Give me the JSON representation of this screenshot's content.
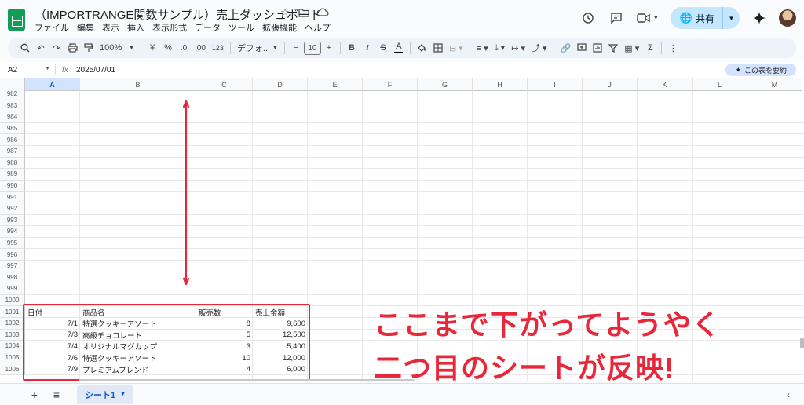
{
  "app": {
    "title": "（IMPORTRANGE関数サンプル）売上ダッシュボード",
    "menu": [
      "ファイル",
      "編集",
      "表示",
      "挿入",
      "表示形式",
      "データ",
      "ツール",
      "拡張機能",
      "ヘルプ"
    ],
    "share_label": "共有"
  },
  "toolbar": {
    "zoom": "100%",
    "currency": "¥",
    "percent": "%",
    "dec_less": ".0",
    "dec_more": ".00",
    "num_format": "123",
    "font": "デフォ...",
    "font_size": "10",
    "minus": "−",
    "plus": "+"
  },
  "formula_bar": {
    "cell_ref": "A2",
    "fx": "fx",
    "value": "2025/07/01",
    "summarize_label": "この表を要約"
  },
  "grid": {
    "columns": [
      "A",
      "B",
      "C",
      "D",
      "E",
      "F",
      "G",
      "H",
      "I",
      "J",
      "K",
      "L",
      "M"
    ],
    "selected_column": "A",
    "row_numbers": [
      "982",
      "983",
      "984",
      "985",
      "986",
      "987",
      "988",
      "989",
      "990",
      "991",
      "992",
      "993",
      "994",
      "995",
      "996",
      "997",
      "998",
      "999",
      "1000",
      "1001",
      "1002",
      "1003",
      "1004",
      "1005",
      "1006"
    ],
    "table": {
      "headers": [
        "日付",
        "商品名",
        "販売数",
        "売上金額"
      ],
      "rows": [
        [
          "7/1",
          "特選クッキーアソート",
          "8",
          "9,600"
        ],
        [
          "7/3",
          "高級チョコレート",
          "5",
          "12,500"
        ],
        [
          "7/4",
          "オリジナルマグカップ",
          "3",
          "5,400"
        ],
        [
          "7/6",
          "特選クッキーアソート",
          "10",
          "12,000"
        ],
        [
          "7/9",
          "プレミアムブレンド",
          "4",
          "6,000"
        ]
      ]
    }
  },
  "annotation": {
    "line1": "ここまで下がってようやく",
    "line2": "二つ目のシートが反映!",
    "color": "#e8283a"
  },
  "sheets": {
    "add": "+",
    "list": "≡",
    "active_tab": "シート1"
  }
}
